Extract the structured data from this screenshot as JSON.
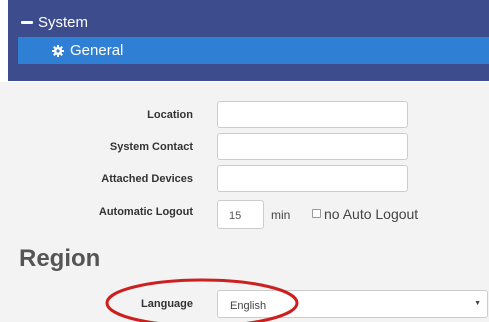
{
  "nav": {
    "section_label": "System",
    "active_item_label": "General",
    "icons": {
      "collapse": "minus-icon",
      "item": "gear-icon"
    },
    "colors": {
      "panel": "#3c4c8d",
      "active": "#2f80d4"
    }
  },
  "form": {
    "location_label": "Location",
    "location_value": "",
    "system_contact_label": "System Contact",
    "system_contact_value": "",
    "attached_devices_label": "Attached Devices",
    "attached_devices_value": "",
    "automatic_logout_label": "Automatic Logout",
    "automatic_logout_value": "15",
    "automatic_logout_unit": "min",
    "no_auto_logout_label": "no Auto Logout",
    "no_auto_logout_checked": false
  },
  "region": {
    "heading": "Region",
    "language_label": "Language",
    "language_value": "English"
  },
  "annotation": {
    "color": "#cc1f1f",
    "shape": "ellipse around Language selector"
  }
}
